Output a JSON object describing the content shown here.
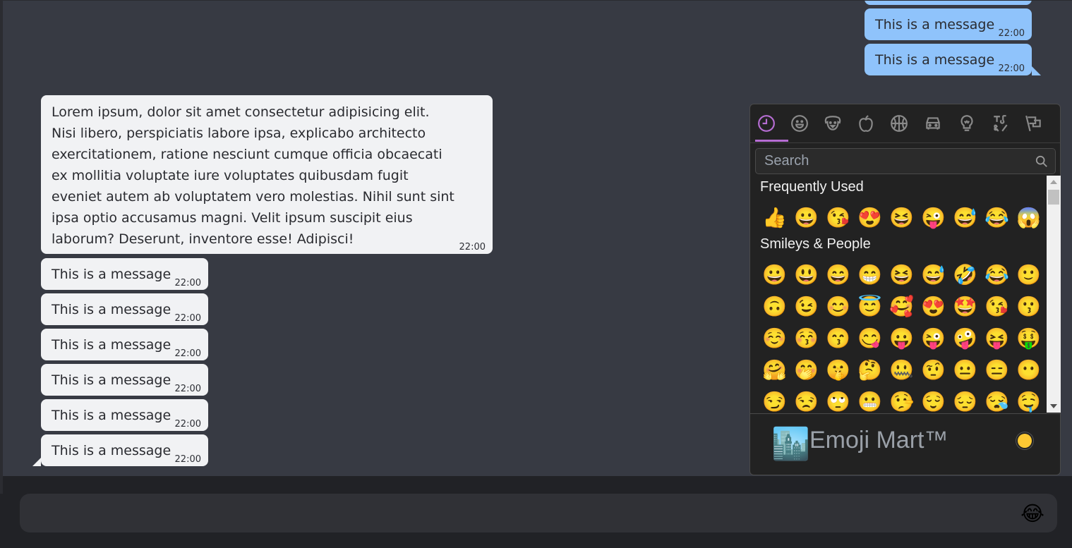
{
  "messages_outgoing": [
    {
      "text": "This is a message",
      "time": "22:00"
    },
    {
      "text": "This is a message",
      "time": "22:00"
    }
  ],
  "messages_incoming": [
    {
      "text": "Lorem ipsum, dolor sit amet consectetur adipisicing elit. Nisi libero, perspiciatis labore ipsa, explicabo architecto exercitationem, ratione nesciunt cumque officia obcaecati ex mollitia voluptate iure voluptates quibusdam fugit eveniet autem ab voluptatem vero molestias. Nihil sunt sint ipsa optio accusamus magni. Velit ipsum suscipit eius laborum? Deserunt, inventore esse! Adipisci!",
      "time": "22:00"
    },
    {
      "text": "This is a message",
      "time": "22:00"
    },
    {
      "text": "This is a message",
      "time": "22:00"
    },
    {
      "text": "This is a message",
      "time": "22:00"
    },
    {
      "text": "This is a message",
      "time": "22:00"
    },
    {
      "text": "This is a message",
      "time": "22:00"
    },
    {
      "text": "This is a message",
      "time": "22:00"
    }
  ],
  "emoji_picker": {
    "accent_color": "#b66dd3",
    "categories": [
      {
        "name": "frequently-used",
        "icon": "clock-icon",
        "active": true
      },
      {
        "name": "smileys-people",
        "icon": "smiley-icon"
      },
      {
        "name": "animals-nature",
        "icon": "dog-icon"
      },
      {
        "name": "food-drink",
        "icon": "apple-icon"
      },
      {
        "name": "activity",
        "icon": "basketball-icon"
      },
      {
        "name": "travel-places",
        "icon": "car-icon"
      },
      {
        "name": "objects",
        "icon": "lightbulb-icon"
      },
      {
        "name": "symbols",
        "icon": "symbols-icon"
      },
      {
        "name": "flags",
        "icon": "flag-icon"
      }
    ],
    "search_placeholder": "Search",
    "sections": [
      {
        "title": "Frequently Used",
        "rows": [
          [
            "👍",
            "😀",
            "😘",
            "😍",
            "😆",
            "😜",
            "😅",
            "😂",
            "😱"
          ]
        ]
      },
      {
        "title": "Smileys & People",
        "rows": [
          [
            "😀",
            "😃",
            "😄",
            "😁",
            "😆",
            "😅",
            "🤣",
            "😂",
            "🙂"
          ],
          [
            "🙃",
            "😉",
            "😊",
            "😇",
            "🥰",
            "😍",
            "🤩",
            "😘",
            "😗"
          ],
          [
            "☺️",
            "😚",
            "😙",
            "😋",
            "😛",
            "😜",
            "🤪",
            "😝",
            "🤑"
          ],
          [
            "🤗",
            "🤭",
            "🤫",
            "🤔",
            "🤐",
            "🤨",
            "😐",
            "😑",
            "😶"
          ],
          [
            "😏",
            "😒",
            "🙄",
            "😬",
            "🤥",
            "😌",
            "😔",
            "😪",
            "🤤"
          ]
        ]
      }
    ],
    "preview_emoji": "🏙️",
    "preview_label": "Emoji Mart™",
    "skin_tone_color": "#fdc933"
  },
  "composer": {
    "placeholder": "",
    "emoji_button": "😂"
  }
}
